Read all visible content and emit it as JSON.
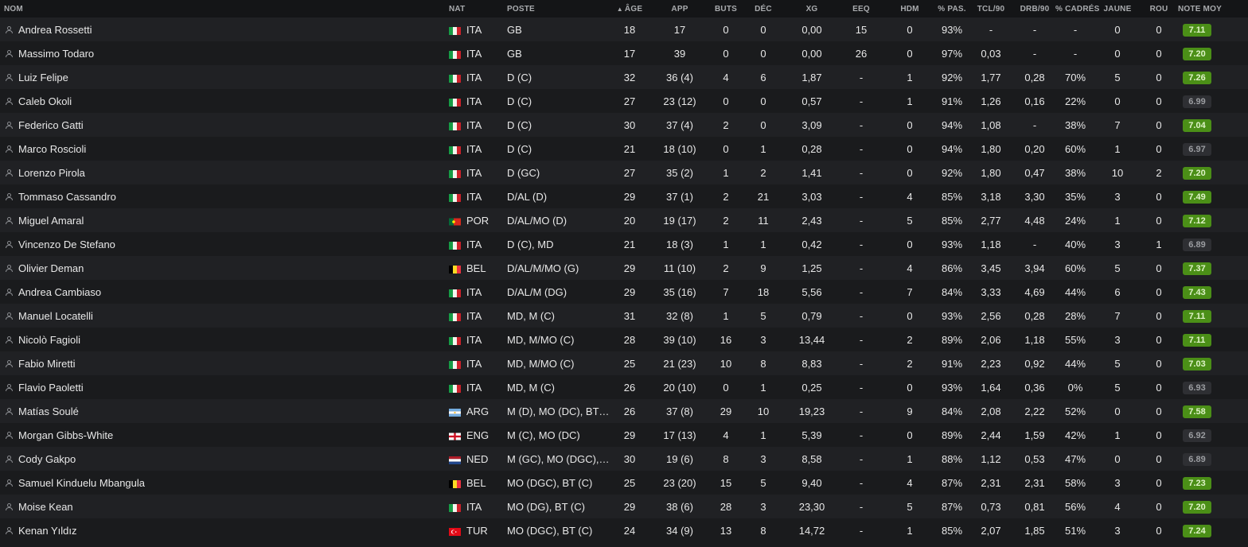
{
  "headers": {
    "nom": "NOM",
    "nat": "NAT",
    "poste": "POSTE",
    "age": "ÂGE",
    "app": "APP",
    "buts": "BUTS",
    "dec": "DÉC",
    "xg": "XG",
    "eeq": "EEQ",
    "hdm": "HDM",
    "pas": "% PAS.",
    "tcl": "TCL/90",
    "drb": "DRB/90",
    "cadres": "% CADRÉS",
    "jaune": "JAUNE",
    "rou": "ROU",
    "note": "NOTE MOY"
  },
  "sort_indicator": "▲",
  "colors": {
    "rating_good": "#4b8f17",
    "rating_neutral": "#2e2f33"
  },
  "players": [
    {
      "name": "Andrea Rossetti",
      "flag": "italy",
      "nat": "ITA",
      "poste": "GB",
      "age": "18",
      "app": "17",
      "buts": "0",
      "dec": "0",
      "xg": "0,00",
      "eeq": "15",
      "hdm": "0",
      "pas": "93%",
      "tcl": "-",
      "drb": "-",
      "cadres": "-",
      "jaune": "0",
      "rou": "0",
      "note": "7.11",
      "tier": "green"
    },
    {
      "name": "Massimo Todaro",
      "flag": "italy",
      "nat": "ITA",
      "poste": "GB",
      "age": "17",
      "app": "39",
      "buts": "0",
      "dec": "0",
      "xg": "0,00",
      "eeq": "26",
      "hdm": "0",
      "pas": "97%",
      "tcl": "0,03",
      "drb": "-",
      "cadres": "-",
      "jaune": "0",
      "rou": "0",
      "note": "7.20",
      "tier": "green"
    },
    {
      "name": "Luiz Felipe",
      "flag": "italy",
      "nat": "ITA",
      "poste": "D (C)",
      "age": "32",
      "app": "36 (4)",
      "buts": "4",
      "dec": "6",
      "xg": "1,87",
      "eeq": "-",
      "hdm": "1",
      "pas": "92%",
      "tcl": "1,77",
      "drb": "0,28",
      "cadres": "70%",
      "jaune": "5",
      "rou": "0",
      "note": "7.26",
      "tier": "green"
    },
    {
      "name": "Caleb Okoli",
      "flag": "italy",
      "nat": "ITA",
      "poste": "D (C)",
      "age": "27",
      "app": "23 (12)",
      "buts": "0",
      "dec": "0",
      "xg": "0,57",
      "eeq": "-",
      "hdm": "1",
      "pas": "91%",
      "tcl": "1,26",
      "drb": "0,16",
      "cadres": "22%",
      "jaune": "0",
      "rou": "0",
      "note": "6.99",
      "tier": "grey"
    },
    {
      "name": "Federico Gatti",
      "flag": "italy",
      "nat": "ITA",
      "poste": "D (C)",
      "age": "30",
      "app": "37 (4)",
      "buts": "2",
      "dec": "0",
      "xg": "3,09",
      "eeq": "-",
      "hdm": "0",
      "pas": "94%",
      "tcl": "1,08",
      "drb": "-",
      "cadres": "38%",
      "jaune": "7",
      "rou": "0",
      "note": "7.04",
      "tier": "green"
    },
    {
      "name": "Marco Roscioli",
      "flag": "italy",
      "nat": "ITA",
      "poste": "D (C)",
      "age": "21",
      "app": "18 (10)",
      "buts": "0",
      "dec": "1",
      "xg": "0,28",
      "eeq": "-",
      "hdm": "0",
      "pas": "94%",
      "tcl": "1,80",
      "drb": "0,20",
      "cadres": "60%",
      "jaune": "1",
      "rou": "0",
      "note": "6.97",
      "tier": "grey"
    },
    {
      "name": "Lorenzo Pirola",
      "flag": "italy",
      "nat": "ITA",
      "poste": "D (GC)",
      "age": "27",
      "app": "35 (2)",
      "buts": "1",
      "dec": "2",
      "xg": "1,41",
      "eeq": "-",
      "hdm": "0",
      "pas": "92%",
      "tcl": "1,80",
      "drb": "0,47",
      "cadres": "38%",
      "jaune": "10",
      "rou": "2",
      "note": "7.20",
      "tier": "green"
    },
    {
      "name": "Tommaso Cassandro",
      "flag": "italy",
      "nat": "ITA",
      "poste": "D/AL (D)",
      "age": "29",
      "app": "37 (1)",
      "buts": "2",
      "dec": "21",
      "xg": "3,03",
      "eeq": "-",
      "hdm": "4",
      "pas": "85%",
      "tcl": "3,18",
      "drb": "3,30",
      "cadres": "35%",
      "jaune": "3",
      "rou": "0",
      "note": "7.49",
      "tier": "green"
    },
    {
      "name": "Miguel Amaral",
      "flag": "portugal",
      "nat": "POR",
      "poste": "D/AL/MO (D)",
      "age": "20",
      "app": "19 (17)",
      "buts": "2",
      "dec": "11",
      "xg": "2,43",
      "eeq": "-",
      "hdm": "5",
      "pas": "85%",
      "tcl": "2,77",
      "drb": "4,48",
      "cadres": "24%",
      "jaune": "1",
      "rou": "0",
      "note": "7.12",
      "tier": "green"
    },
    {
      "name": "Vincenzo De Stefano",
      "flag": "italy",
      "nat": "ITA",
      "poste": "D (C), MD",
      "age": "21",
      "app": "18 (3)",
      "buts": "1",
      "dec": "1",
      "xg": "0,42",
      "eeq": "-",
      "hdm": "0",
      "pas": "93%",
      "tcl": "1,18",
      "drb": "-",
      "cadres": "40%",
      "jaune": "3",
      "rou": "1",
      "note": "6.89",
      "tier": "grey"
    },
    {
      "name": "Olivier Deman",
      "flag": "belgium",
      "nat": "BEL",
      "poste": "D/AL/M/MO (G)",
      "age": "29",
      "app": "11 (10)",
      "buts": "2",
      "dec": "9",
      "xg": "1,25",
      "eeq": "-",
      "hdm": "4",
      "pas": "86%",
      "tcl": "3,45",
      "drb": "3,94",
      "cadres": "60%",
      "jaune": "5",
      "rou": "0",
      "note": "7.37",
      "tier": "green"
    },
    {
      "name": "Andrea Cambiaso",
      "flag": "italy",
      "nat": "ITA",
      "poste": "D/AL/M (DG)",
      "age": "29",
      "app": "35 (16)",
      "buts": "7",
      "dec": "18",
      "xg": "5,56",
      "eeq": "-",
      "hdm": "7",
      "pas": "84%",
      "tcl": "3,33",
      "drb": "4,69",
      "cadres": "44%",
      "jaune": "6",
      "rou": "0",
      "note": "7.43",
      "tier": "green"
    },
    {
      "name": "Manuel Locatelli",
      "flag": "italy",
      "nat": "ITA",
      "poste": "MD, M (C)",
      "age": "31",
      "app": "32 (8)",
      "buts": "1",
      "dec": "5",
      "xg": "0,79",
      "eeq": "-",
      "hdm": "0",
      "pas": "93%",
      "tcl": "2,56",
      "drb": "0,28",
      "cadres": "28%",
      "jaune": "7",
      "rou": "0",
      "note": "7.11",
      "tier": "green"
    },
    {
      "name": "Nicolò Fagioli",
      "flag": "italy",
      "nat": "ITA",
      "poste": "MD, M/MO (C)",
      "age": "28",
      "app": "39 (10)",
      "buts": "16",
      "dec": "3",
      "xg": "13,44",
      "eeq": "-",
      "hdm": "2",
      "pas": "89%",
      "tcl": "2,06",
      "drb": "1,18",
      "cadres": "55%",
      "jaune": "3",
      "rou": "0",
      "note": "7.11",
      "tier": "green"
    },
    {
      "name": "Fabio Miretti",
      "flag": "italy",
      "nat": "ITA",
      "poste": "MD, M/MO (C)",
      "age": "25",
      "app": "21 (23)",
      "buts": "10",
      "dec": "8",
      "xg": "8,83",
      "eeq": "-",
      "hdm": "2",
      "pas": "91%",
      "tcl": "2,23",
      "drb": "0,92",
      "cadres": "44%",
      "jaune": "5",
      "rou": "0",
      "note": "7.03",
      "tier": "green"
    },
    {
      "name": "Flavio Paoletti",
      "flag": "italy",
      "nat": "ITA",
      "poste": "MD, M (C)",
      "age": "26",
      "app": "20 (10)",
      "buts": "0",
      "dec": "1",
      "xg": "0,25",
      "eeq": "-",
      "hdm": "0",
      "pas": "93%",
      "tcl": "1,64",
      "drb": "0,36",
      "cadres": "0%",
      "jaune": "5",
      "rou": "0",
      "note": "6.93",
      "tier": "grey"
    },
    {
      "name": "Matías Soulé",
      "flag": "argentina",
      "nat": "ARG",
      "poste": "M (D), MO (DC), BT (C)",
      "age": "26",
      "app": "37 (8)",
      "buts": "29",
      "dec": "10",
      "xg": "19,23",
      "eeq": "-",
      "hdm": "9",
      "pas": "84%",
      "tcl": "2,08",
      "drb": "2,22",
      "cadres": "52%",
      "jaune": "0",
      "rou": "0",
      "note": "7.58",
      "tier": "green"
    },
    {
      "name": "Morgan Gibbs-White",
      "flag": "england",
      "nat": "ENG",
      "poste": "M (C), MO (DC)",
      "age": "29",
      "app": "17 (13)",
      "buts": "4",
      "dec": "1",
      "xg": "5,39",
      "eeq": "-",
      "hdm": "0",
      "pas": "89%",
      "tcl": "2,44",
      "drb": "1,59",
      "cadres": "42%",
      "jaune": "1",
      "rou": "0",
      "note": "6.92",
      "tier": "grey"
    },
    {
      "name": "Cody Gakpo",
      "flag": "netherlands",
      "nat": "NED",
      "poste": "M (GC), MO (DGC), BT...",
      "age": "30",
      "app": "19 (6)",
      "buts": "8",
      "dec": "3",
      "xg": "8,58",
      "eeq": "-",
      "hdm": "1",
      "pas": "88%",
      "tcl": "1,12",
      "drb": "0,53",
      "cadres": "47%",
      "jaune": "0",
      "rou": "0",
      "note": "6.89",
      "tier": "grey"
    },
    {
      "name": "Samuel Kinduelu Mbangula",
      "flag": "belgium",
      "nat": "BEL",
      "poste": "MO (DGC), BT (C)",
      "age": "25",
      "app": "23 (20)",
      "buts": "15",
      "dec": "5",
      "xg": "9,40",
      "eeq": "-",
      "hdm": "4",
      "pas": "87%",
      "tcl": "2,31",
      "drb": "2,31",
      "cadres": "58%",
      "jaune": "3",
      "rou": "0",
      "note": "7.23",
      "tier": "green"
    },
    {
      "name": "Moise Kean",
      "flag": "italy",
      "nat": "ITA",
      "poste": "MO (DG), BT (C)",
      "age": "29",
      "app": "38 (6)",
      "buts": "28",
      "dec": "3",
      "xg": "23,30",
      "eeq": "-",
      "hdm": "5",
      "pas": "87%",
      "tcl": "0,73",
      "drb": "0,81",
      "cadres": "56%",
      "jaune": "4",
      "rou": "0",
      "note": "7.20",
      "tier": "green"
    },
    {
      "name": "Kenan Yıldız",
      "flag": "turkey",
      "nat": "TUR",
      "poste": "MO (DGC), BT (C)",
      "age": "24",
      "app": "34 (9)",
      "buts": "13",
      "dec": "8",
      "xg": "14,72",
      "eeq": "-",
      "hdm": "1",
      "pas": "85%",
      "tcl": "2,07",
      "drb": "1,85",
      "cadres": "51%",
      "jaune": "3",
      "rou": "0",
      "note": "7.24",
      "tier": "green"
    }
  ]
}
